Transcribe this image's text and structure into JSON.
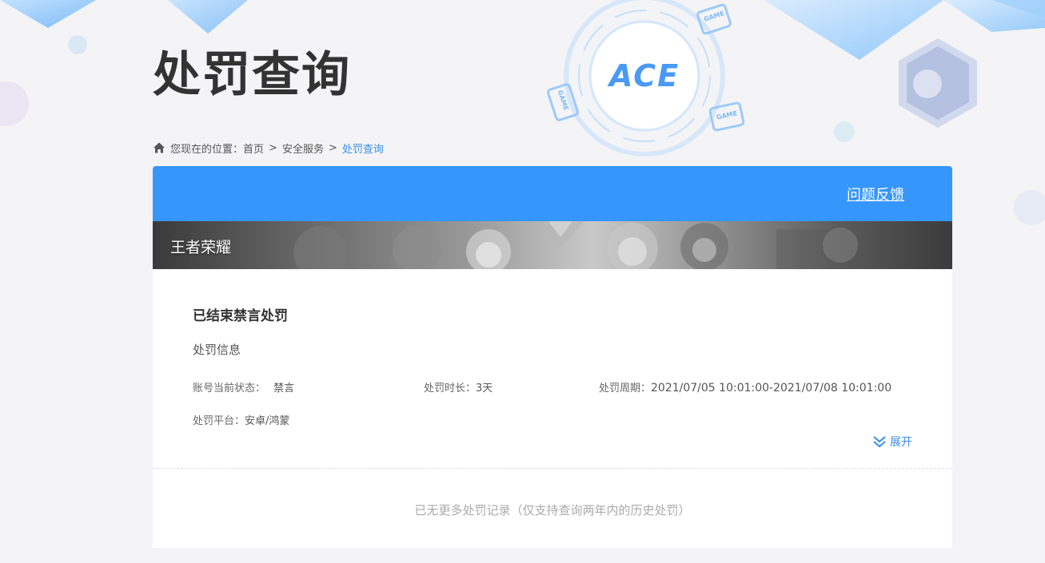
{
  "header": {
    "title": "处罚查询"
  },
  "breadcrumb": {
    "prefix": "您现在的位置：",
    "items": [
      "首页",
      "安全服务",
      "处罚查询"
    ],
    "separator": ">"
  },
  "toolbar": {
    "feedback_label": "问题反馈"
  },
  "game": {
    "name": "王者荣耀"
  },
  "record": {
    "title": "已结束禁言处罚",
    "section_label": "处罚信息",
    "status_label": "账号当前状态：",
    "status_value": "禁言",
    "duration_label": "处罚时长：",
    "duration_value": "3天",
    "period_label": "处罚周期：",
    "period_value": "2021/07/05 10:01:00-2021/07/08 10:01:00",
    "platform_label": "处罚平台：",
    "platform_value": "安卓/鸿蒙",
    "expand_label": "展开"
  },
  "footer": {
    "no_more_text": "已无更多处罚记录（仅支持查询两年内的历史处罚）"
  },
  "logo": {
    "text": "ACE",
    "badge_text": "GAME"
  },
  "colors": {
    "primary_blue": "#3596fb",
    "link_blue": "#3a8ee6",
    "page_bg": "#f4f4f6"
  }
}
